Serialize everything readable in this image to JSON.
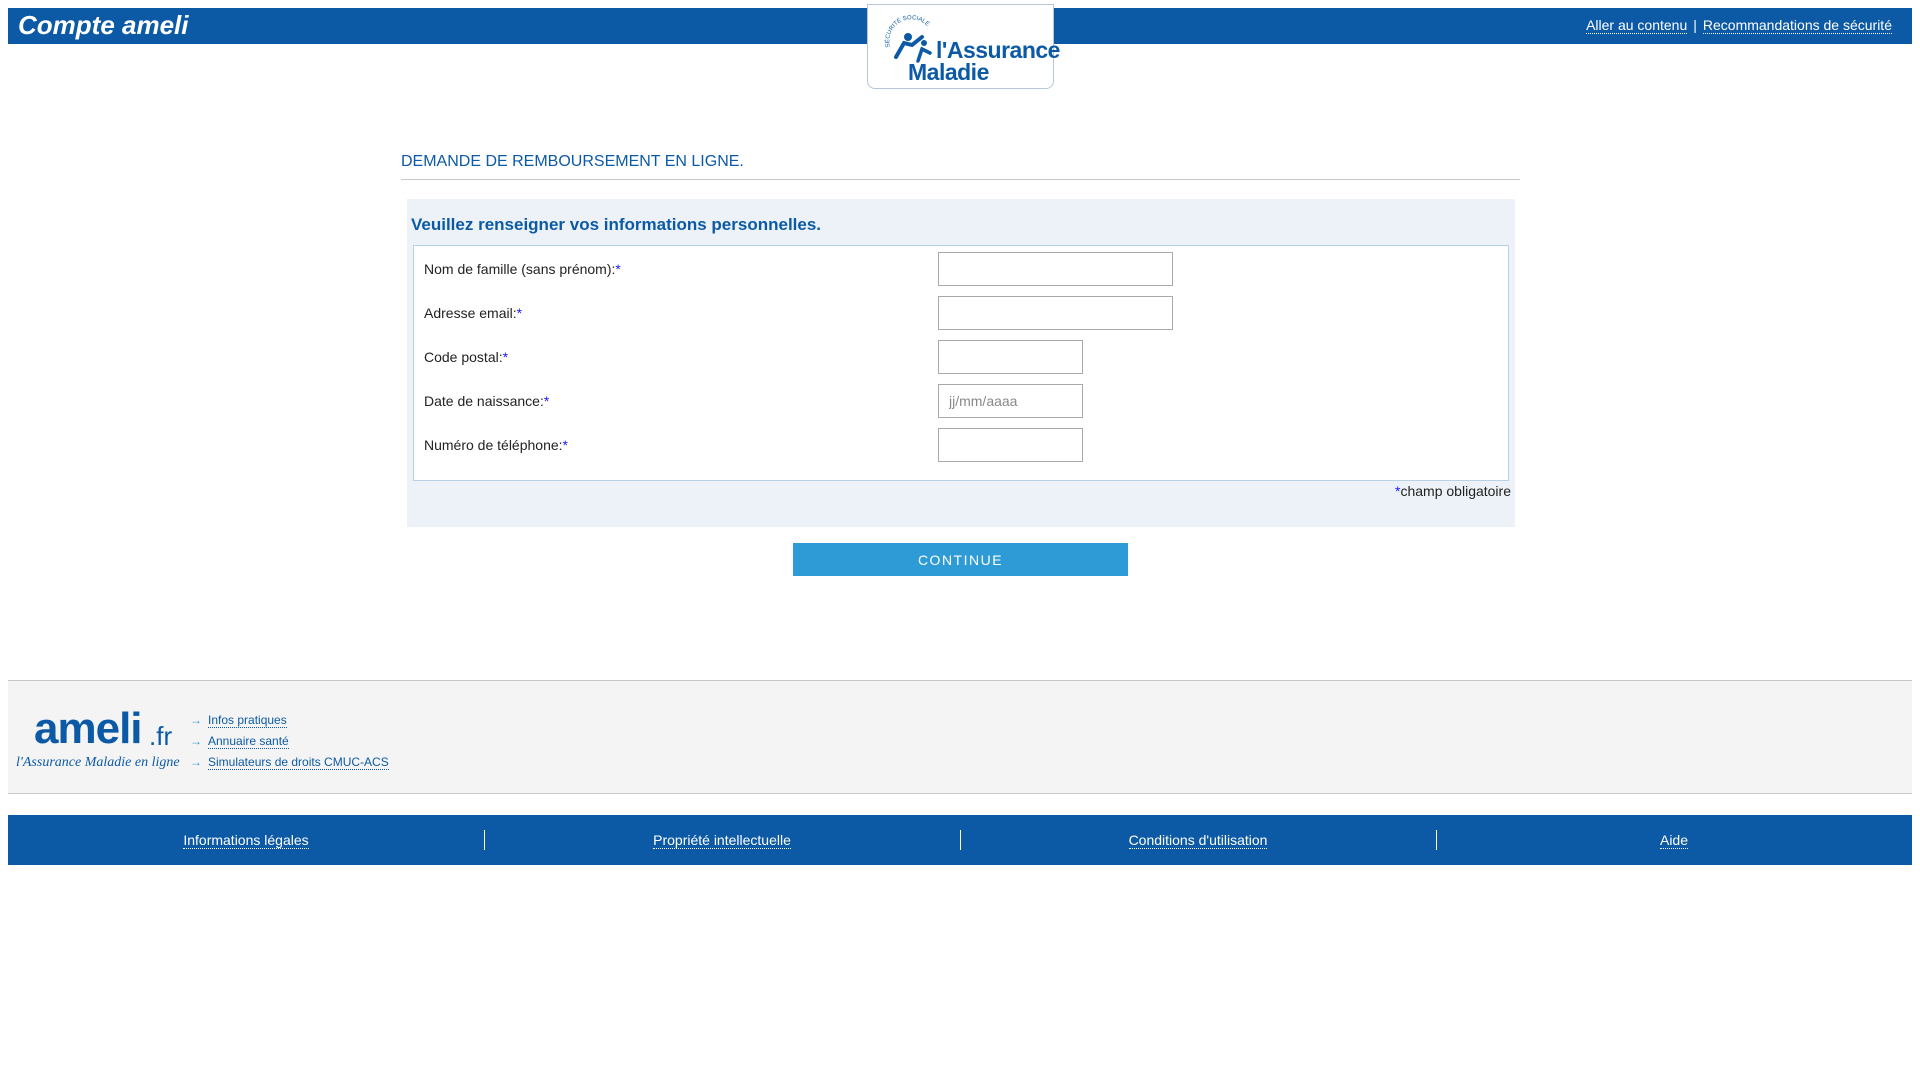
{
  "header": {
    "app_title": "Compte ameli",
    "links": {
      "skip_to_content": "Aller au contenu",
      "separator": "|",
      "security_recommendations": "Recommandations de sécurité"
    },
    "logo": {
      "arc_text": "SÉCURITÉ SOCIALE",
      "line1": "l'Assurance",
      "line2": "Maladie"
    }
  },
  "page": {
    "heading": "DEMANDE DE REMBOURSEMENT EN LIGNE."
  },
  "form": {
    "title": "Veuillez renseigner vos informations personnelles.",
    "required_marker": "*",
    "fields": {
      "last_name": {
        "label": "Nom de famille (sans prénom):",
        "value": "",
        "placeholder": ""
      },
      "email": {
        "label": "Adresse email:",
        "value": "",
        "placeholder": ""
      },
      "postal_code": {
        "label": "Code postal:",
        "value": "",
        "placeholder": ""
      },
      "birth_date": {
        "label": "Date de naissance:",
        "value": "",
        "placeholder": "jj/mm/aaaa"
      },
      "phone": {
        "label": "Numéro de téléphone:",
        "value": "",
        "placeholder": ""
      }
    },
    "mandatory_note": "champ obligatoire",
    "continue_label": "CONTINUE"
  },
  "footer": {
    "brand": {
      "name": "ameli",
      "tld": ".fr",
      "tagline": "l'Assurance Maladie en ligne"
    },
    "links": [
      "Infos pratiques",
      "Annuaire santé",
      "Simulateurs de droits CMUC-ACS"
    ],
    "bar_links": [
      "Informations légales",
      "Propriété intellectuelle",
      "Conditions d'utilisation",
      "Aide"
    ]
  },
  "colors": {
    "brand_blue": "#0c5aa6",
    "button_blue": "#2e9bd6",
    "panel_bg": "#ecf2f7",
    "required_marker": "#1a1aff"
  }
}
